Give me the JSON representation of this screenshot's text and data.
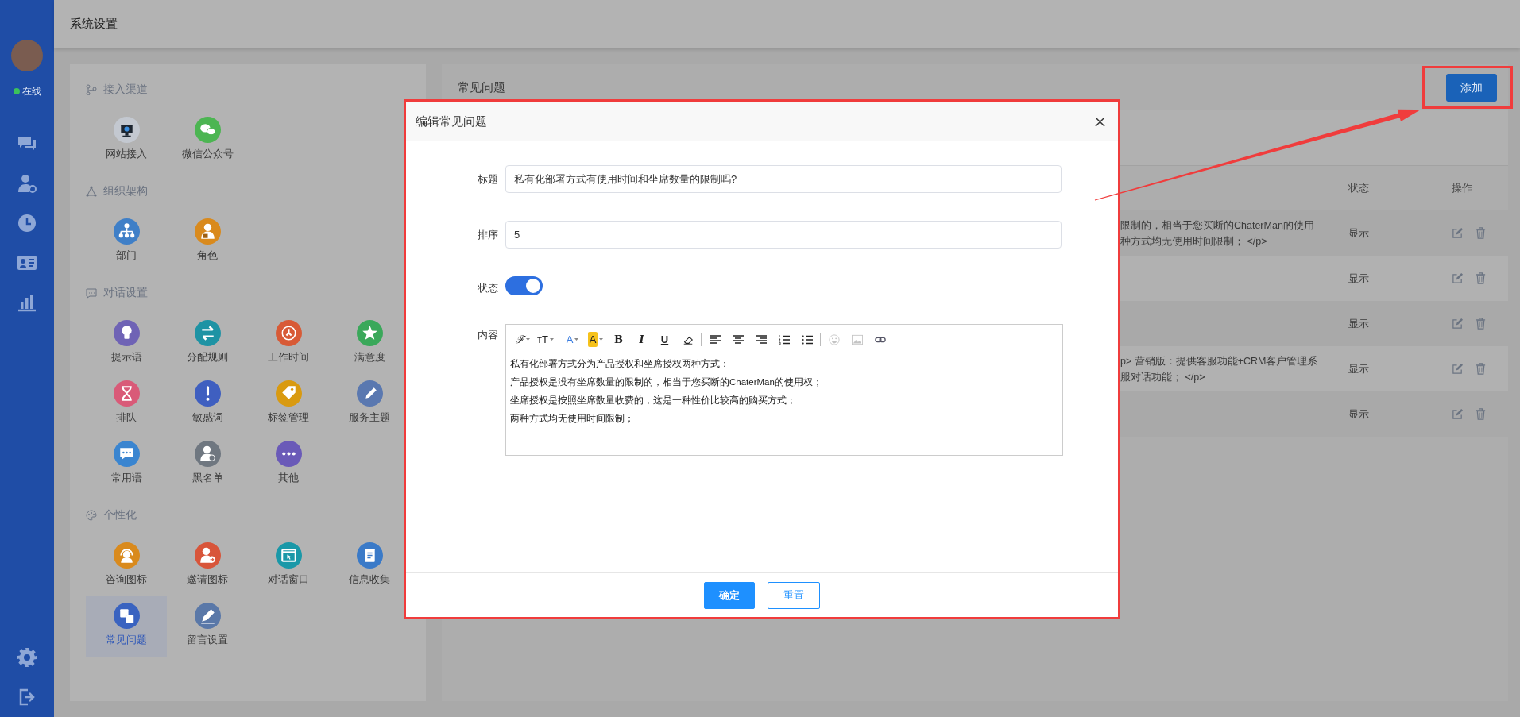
{
  "header": {
    "title": "系统设置"
  },
  "sidebar": {
    "status": "在线",
    "online": true
  },
  "settings": {
    "sections": [
      {
        "title": "接入渠道",
        "items": [
          {
            "label": "网站接入",
            "color": "#c3c8d0",
            "selected": false
          },
          {
            "label": "微信公众号",
            "color": "#4cb552",
            "selected": false
          }
        ]
      },
      {
        "title": "组织架构",
        "items": [
          {
            "label": "部门",
            "color": "#3f7fc7",
            "selected": false
          },
          {
            "label": "角色",
            "color": "#d98a1d",
            "selected": false
          }
        ]
      },
      {
        "title": "对话设置",
        "items": [
          {
            "label": "提示语",
            "color": "#6f63b5",
            "selected": false
          },
          {
            "label": "分配规则",
            "color": "#1e93a4",
            "selected": false
          },
          {
            "label": "工作时间",
            "color": "#d85a36",
            "selected": false
          },
          {
            "label": "满意度",
            "color": "#3aa85a",
            "selected": false
          },
          {
            "label": "排队",
            "color": "#d95a78",
            "selected": false
          },
          {
            "label": "敏感词",
            "color": "#3f5fc0",
            "selected": false
          },
          {
            "label": "标签管理",
            "color": "#d99a10",
            "selected": false
          },
          {
            "label": "服务主题",
            "color": "#5a78b0",
            "selected": false
          },
          {
            "label": "常用语",
            "color": "#3a85d0",
            "selected": false
          },
          {
            "label": "黑名单",
            "color": "#6f7780",
            "selected": false
          },
          {
            "label": "其他",
            "color": "#6a5ab8",
            "selected": false
          }
        ]
      },
      {
        "title": "个性化",
        "items": [
          {
            "label": "咨询图标",
            "color": "#d98a1d",
            "selected": false
          },
          {
            "label": "邀请图标",
            "color": "#d8553a",
            "selected": false
          },
          {
            "label": "对话窗口",
            "color": "#1a98a8",
            "selected": false
          },
          {
            "label": "信息收集",
            "color": "#3a7ac8",
            "selected": false
          },
          {
            "label": "常见问题",
            "color": "#3a63c0",
            "selected": true
          },
          {
            "label": "留言设置",
            "color": "#5a78a8",
            "selected": false
          }
        ]
      }
    ]
  },
  "faq_panel": {
    "title": "常见问题",
    "add_button": "添加",
    "table": {
      "columns": [
        "状态",
        "操作"
      ],
      "rows": [
        {
          "content": [
            "限制的，相当于您买断的ChaterMan的使用",
            "种方式均无使用时间限制； </p>"
          ],
          "status": "显示"
        },
        {
          "status": "显示"
        },
        {
          "status": "显示"
        },
        {
          "content": [
            "p> 营销版：提供客服功能+CRM客户管理系",
            "服对话功能； </p>"
          ],
          "status": "显示"
        },
        {
          "status": "显示"
        }
      ]
    }
  },
  "modal": {
    "title": "编辑常见问题",
    "fields": [
      {
        "kind": "text",
        "label": "标题",
        "value": "私有化部署方式有使用时间和坐席数量的限制吗?"
      },
      {
        "kind": "text",
        "label": "排序",
        "value": "5"
      },
      {
        "kind": "switch",
        "label": "状态",
        "on": true
      },
      {
        "kind": "editor",
        "label": "内容",
        "toolbar": [
          [
            {
              "kind": "font",
              "glyph": "ℱ",
              "dropdown": true,
              "disabled": false
            },
            {
              "kind": "size",
              "glyph": "ᴛT",
              "dropdown": true,
              "disabled": false
            }
          ],
          [
            {
              "kind": "color",
              "glyph": "A",
              "dropdown": true,
              "disabled": false
            },
            {
              "kind": "highlight",
              "glyph": "A",
              "dropdown": true,
              "disabled": false
            },
            {
              "kind": "bold",
              "glyph": "B",
              "dropdown": false,
              "disabled": false
            },
            {
              "kind": "italic",
              "glyph": "I",
              "dropdown": false,
              "disabled": false
            },
            {
              "kind": "underline",
              "glyph": "U",
              "dropdown": false,
              "disabled": false
            },
            {
              "kind": "eraser",
              "dropdown": false,
              "disabled": false
            }
          ],
          [
            {
              "kind": "align-left",
              "dropdown": false,
              "disabled": false
            },
            {
              "kind": "align-center",
              "dropdown": false,
              "disabled": false
            },
            {
              "kind": "align-right",
              "dropdown": false,
              "disabled": false
            },
            {
              "kind": "ordered-list",
              "dropdown": false,
              "disabled": false
            },
            {
              "kind": "bullet-list",
              "dropdown": false,
              "disabled": false
            }
          ],
          [
            {
              "kind": "emoji",
              "dropdown": false,
              "disabled": true
            },
            {
              "kind": "image",
              "dropdown": false,
              "disabled": true
            },
            {
              "kind": "link",
              "dropdown": false,
              "disabled": false
            }
          ]
        ],
        "paragraphs": [
          "私有化部署方式分为产品授权和坐席授权两种方式：",
          "产品授权是没有坐席数量的限制的，相当于您买断的ChaterMan的使用权；",
          "坐席授权是按照坐席数量收费的，这是一种性价比较高的购买方式；",
          "两种方式均无使用时间限制；"
        ]
      }
    ],
    "buttons": [
      {
        "label": "确定",
        "kind": "primary"
      },
      {
        "label": "重置",
        "kind": "outline"
      }
    ]
  }
}
